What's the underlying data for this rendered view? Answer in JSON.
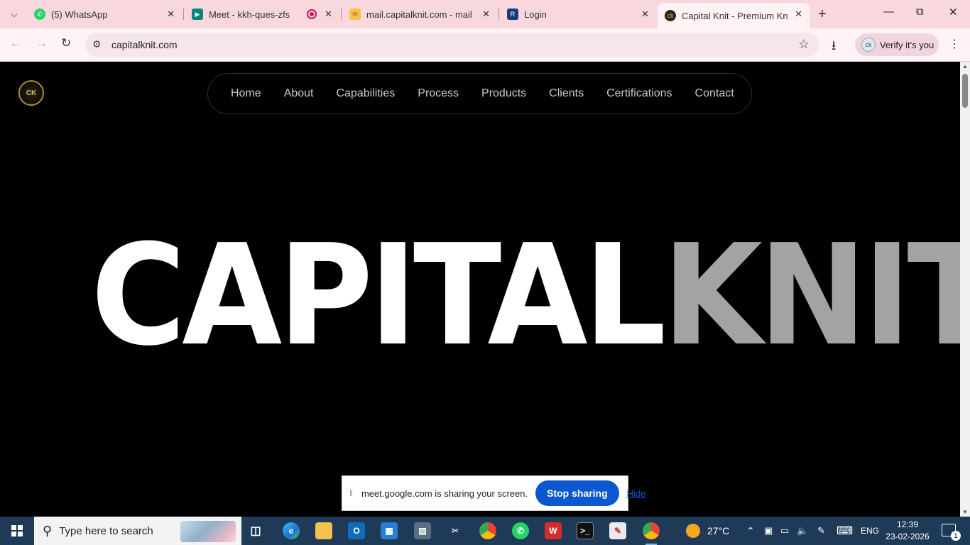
{
  "browser": {
    "tabs": [
      {
        "title": "(5) WhatsApp",
        "favicon": "whatsapp-icon",
        "color": "#25d366"
      },
      {
        "title": "Meet - kkh-ques-zfs",
        "favicon": "meet-icon",
        "color": "#00897b"
      },
      {
        "title": "mail.capitalknit.com - mail U",
        "favicon": "mail-icon",
        "color": "#f4c542"
      },
      {
        "title": "Login",
        "favicon": "login-icon",
        "color": "#1a3a7a"
      },
      {
        "title": "Capital Knit - Premium Knitw",
        "favicon": "capitalknit-icon",
        "color": "#2b2417"
      }
    ],
    "url": "capitalknit.com",
    "verify_label": "Verify it's you",
    "avatar_initials": "ck"
  },
  "site": {
    "logo_text": "CK",
    "nav": [
      "Home",
      "About",
      "Capabilities",
      "Process",
      "Products",
      "Clients",
      "Certifications",
      "Contact"
    ],
    "hero_white": "CAPITAL",
    "hero_gray": "KNIT"
  },
  "share_bar": {
    "message": "meet.google.com is sharing your screen.",
    "stop_label": "Stop sharing",
    "hide_label": "Hide"
  },
  "taskbar": {
    "search_placeholder": "Type here to search",
    "weather": "27°C",
    "language": "ENG",
    "time": "12:39",
    "date": "23-02-2026",
    "notification_count": "1"
  },
  "colors": {
    "tabbar": "#f8d7dd",
    "page_bg": "#000000",
    "hero_gray": "#a3a3a3",
    "accent_blue": "#0b57d0",
    "taskbar": "#1f3a57"
  }
}
